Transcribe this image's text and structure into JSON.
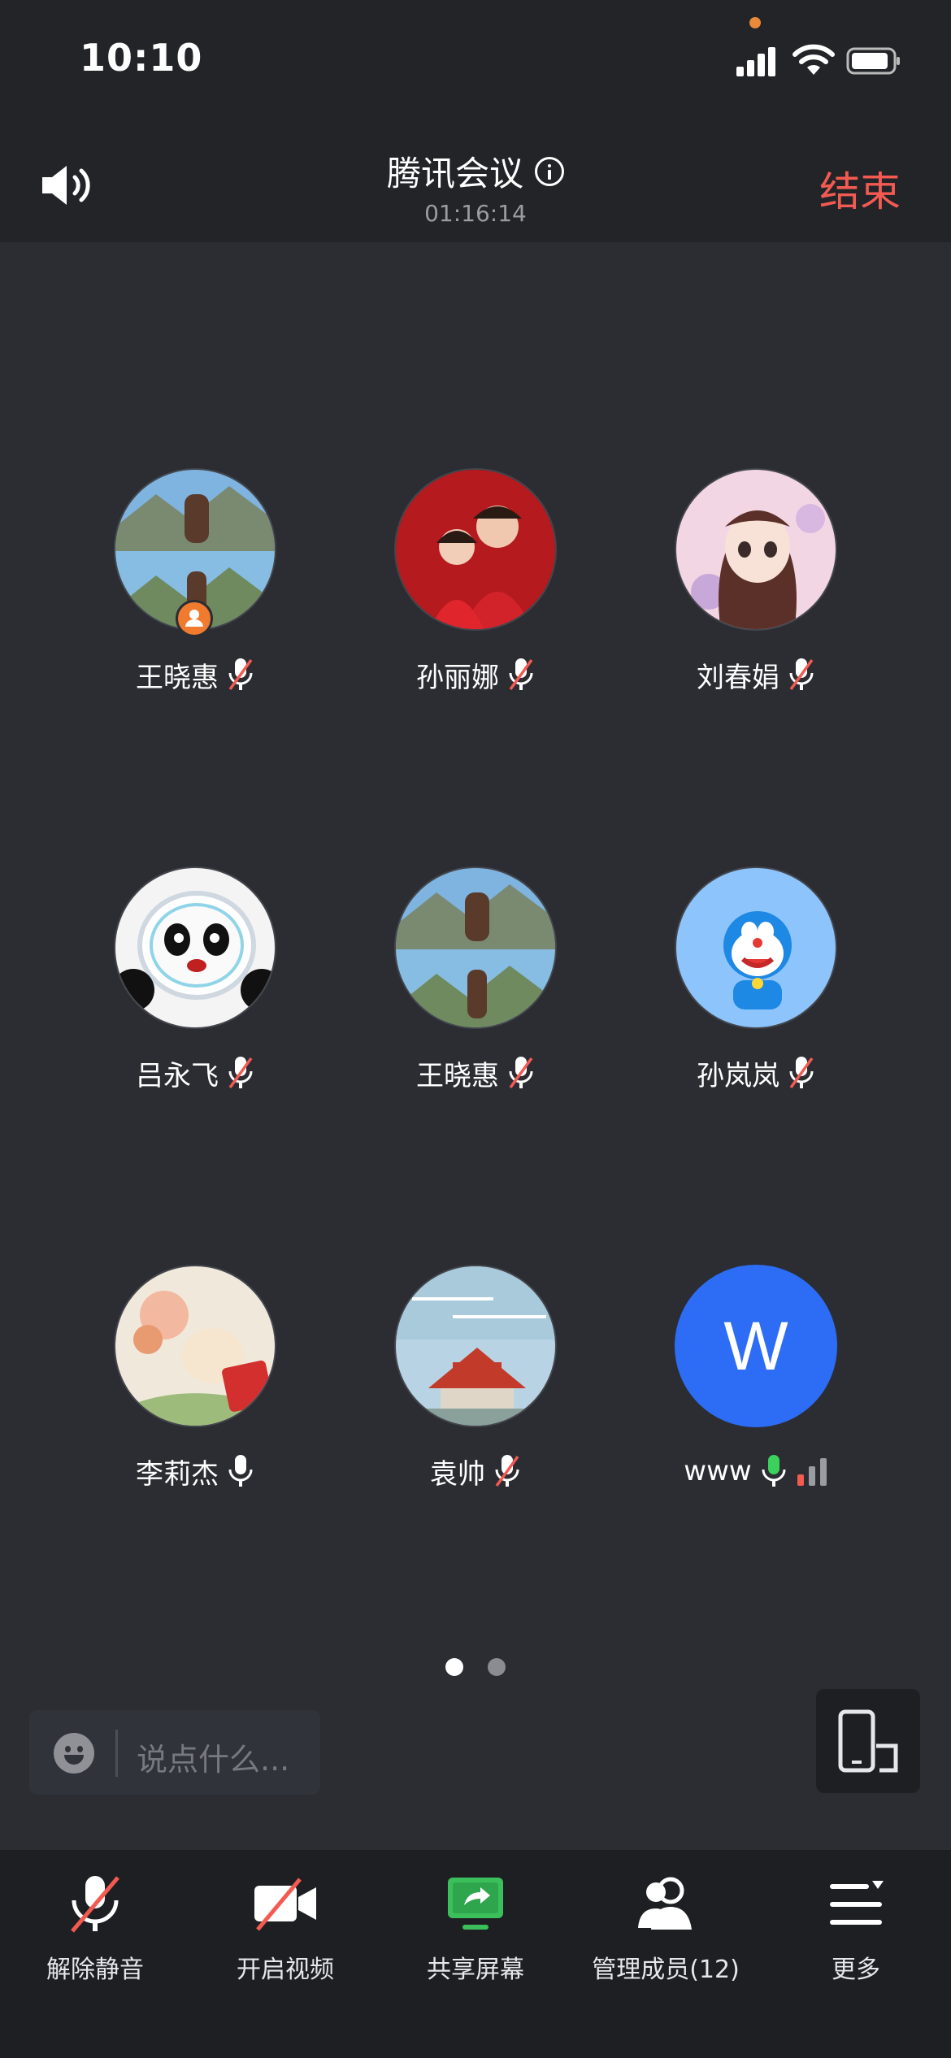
{
  "status_bar": {
    "time": "10:10"
  },
  "header": {
    "title": "腾讯会议",
    "duration": "01:16:14",
    "end_label": "结束"
  },
  "participants": [
    {
      "name": "王晓惠",
      "mic": "muted",
      "host": true
    },
    {
      "name": "孙丽娜",
      "mic": "muted"
    },
    {
      "name": "刘春娟",
      "mic": "muted"
    },
    {
      "name": "吕永飞",
      "mic": "muted"
    },
    {
      "name": "王晓惠",
      "mic": "muted"
    },
    {
      "name": "孙岚岚",
      "mic": "muted"
    },
    {
      "name": "李莉杰",
      "mic": "on"
    },
    {
      "name": "袁帅",
      "mic": "muted"
    },
    {
      "name": "www",
      "mic": "speaking",
      "avatar_letter": "W"
    }
  ],
  "pagination": {
    "current": 1,
    "total": 2
  },
  "chat": {
    "placeholder": "说点什么..."
  },
  "toolbar": {
    "unmute_label": "解除静音",
    "video_label": "开启视频",
    "share_label": "共享屏幕",
    "members_label": "管理成员(12)",
    "more_label": "更多"
  },
  "colors": {
    "end": "#f35a52",
    "share_icon": "#3bbf5b",
    "speaking_mic": "#3bd15c",
    "letter_avatar": "#2d6df6",
    "host_badge": "#f07a2e"
  }
}
